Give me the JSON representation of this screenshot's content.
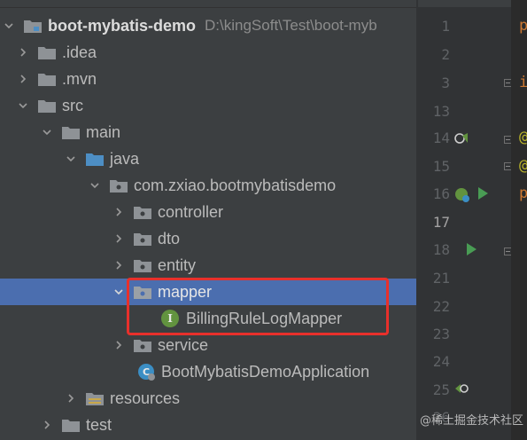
{
  "project_tree": {
    "rows": [
      {
        "label": "boot-mybatis-demo",
        "path": "D:\\kingSoft\\Test\\boot-myb"
      },
      {
        "label": ".idea"
      },
      {
        "label": ".mvn"
      },
      {
        "label": "src"
      },
      {
        "label": "main"
      },
      {
        "label": "java"
      },
      {
        "label": "com.zxiao.bootmybatisdemo"
      },
      {
        "label": "controller"
      },
      {
        "label": "dto"
      },
      {
        "label": "entity"
      },
      {
        "label": "mapper"
      },
      {
        "label": "BillingRuleLogMapper",
        "badge": "I"
      },
      {
        "label": "service"
      },
      {
        "label": "BootMybatisDemoApplication"
      },
      {
        "label": "resources"
      },
      {
        "label": "test"
      }
    ],
    "selected": "mapper"
  },
  "editor": {
    "line_numbers": [
      "1",
      "2",
      "3",
      "13",
      "14",
      "15",
      "16",
      "17",
      "18",
      "21",
      "22",
      "23",
      "24",
      "25",
      "26"
    ],
    "current_line": "17",
    "code_chars": [
      "p",
      "i",
      "@",
      "@",
      "p"
    ]
  },
  "watermark": "@稀土掘金技术社区",
  "colors": {
    "panel_bg": "#3c3f41",
    "selection": "#4b6eaf",
    "highlight_box": "#e8302b",
    "interface_badge": "#62933f",
    "folder": "#8e9296",
    "java_folder": "#4d8ec4"
  }
}
